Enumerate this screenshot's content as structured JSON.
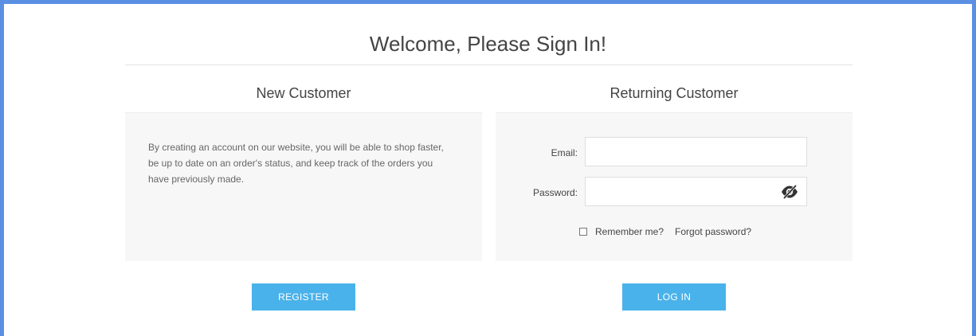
{
  "page": {
    "title": "Welcome, Please Sign In!",
    "accent_color": "#4ab2ea",
    "frame_color": "#5b8fe3"
  },
  "new_customer": {
    "heading": "New Customer",
    "description": "By creating an account on our website, you will be able to shop faster, be up to date on an order's status, and keep track of the orders you have previously made.",
    "register_label": "REGISTER"
  },
  "returning_customer": {
    "heading": "Returning Customer",
    "email_label": "Email:",
    "email_value": "",
    "password_label": "Password:",
    "password_value": "",
    "password_toggle_icon": "eye-slash-icon",
    "remember_label": "Remember me?",
    "remember_checked": false,
    "forgot_label": "Forgot password?",
    "login_label": "LOG IN"
  }
}
